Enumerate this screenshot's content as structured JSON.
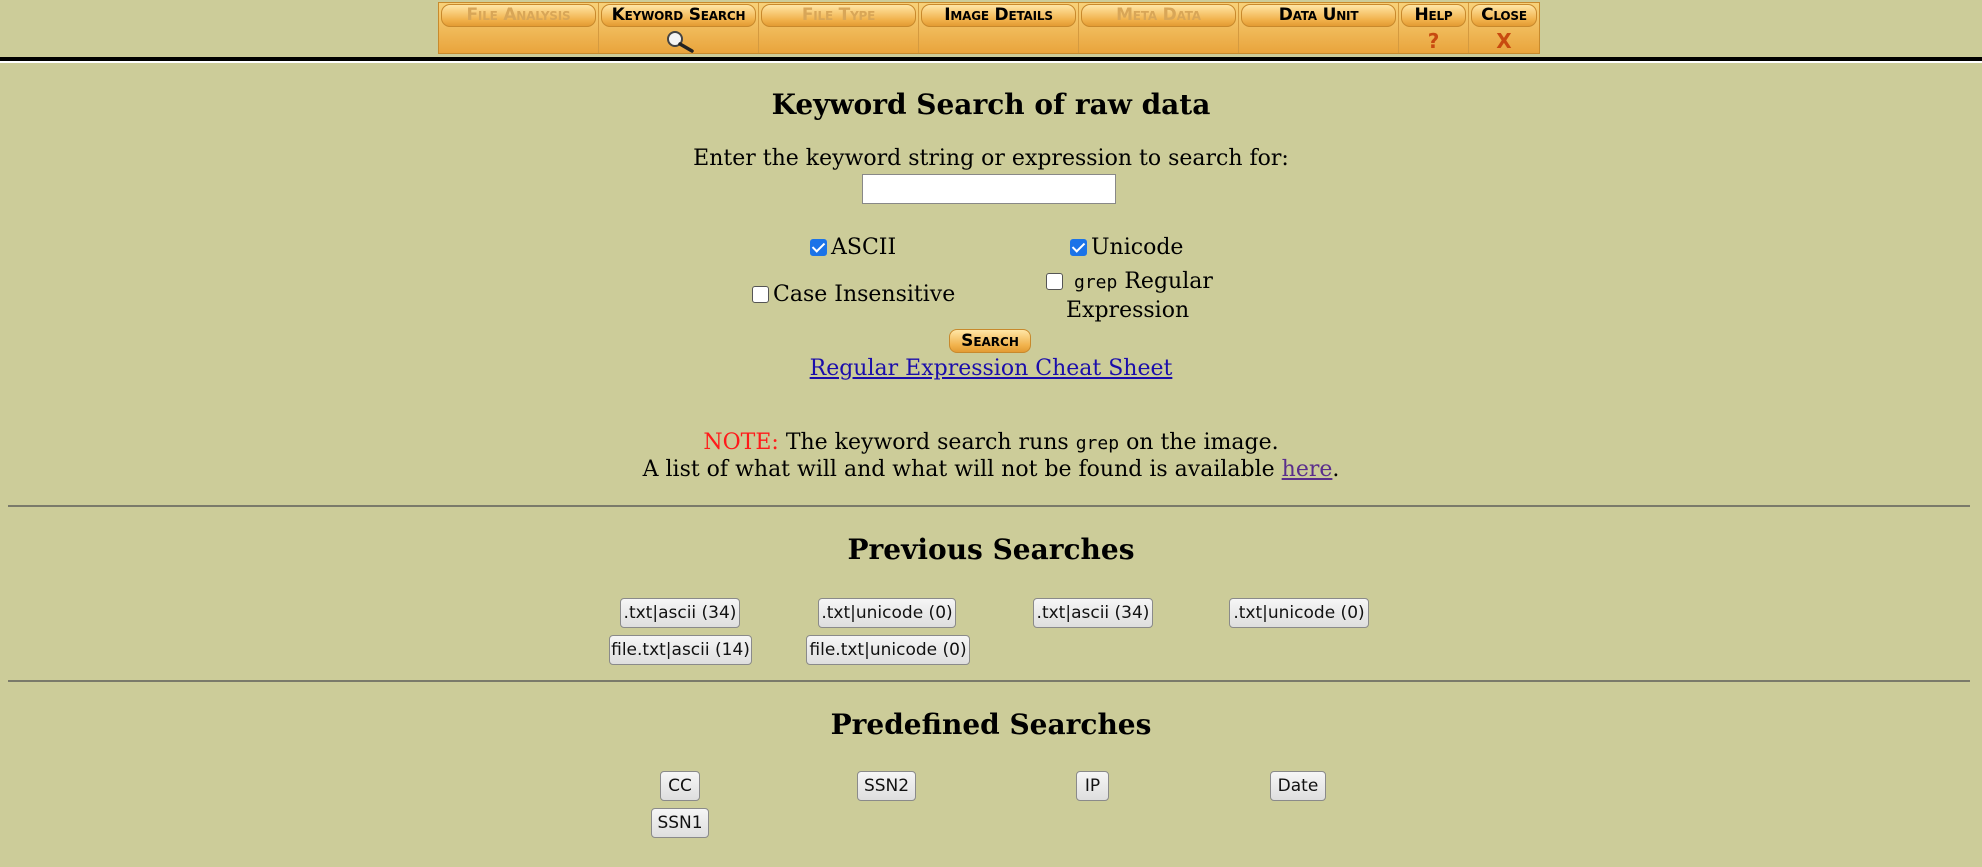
{
  "menu": {
    "tabs": [
      {
        "label": "File Analysis",
        "icon": "",
        "enabled": false
      },
      {
        "label": "Keyword Search",
        "icon": "magnifier-icon",
        "enabled": true
      },
      {
        "label": "File Type",
        "icon": "",
        "enabled": false
      },
      {
        "label": "Image Details",
        "icon": "",
        "enabled": true
      },
      {
        "label": "Meta Data",
        "icon": "",
        "enabled": false
      },
      {
        "label": "Data Unit",
        "icon": "",
        "enabled": true
      },
      {
        "label": "Help",
        "icon_text": "?",
        "enabled": true
      },
      {
        "label": "Close",
        "icon_text": "X",
        "enabled": true
      }
    ]
  },
  "keyword_search": {
    "title": "Keyword Search of raw data",
    "prompt": "Enter the keyword string or expression to search for:",
    "input_value": "",
    "options": {
      "ascii": {
        "label": "ASCII",
        "checked": true
      },
      "unicode": {
        "label": "Unicode",
        "checked": true
      },
      "case_insensitive": {
        "label": "Case Insensitive",
        "checked": false
      },
      "grep_regex": {
        "label_mono": "grep",
        "label_line1": "Regular",
        "label_line2": "Expression",
        "checked": false
      }
    },
    "search_button": "Search",
    "cheat_sheet_link": "Regular Expression Cheat Sheet",
    "note": {
      "label": "NOTE:",
      "text_before": "The keyword search runs",
      "mono": "grep",
      "text_after": "on the image.",
      "line2": "A list of what will and what will not be found is available",
      "link": "here",
      "period": "."
    }
  },
  "previous_searches": {
    "title": "Previous Searches",
    "items": [
      ".txt|ascii (34)",
      ".txt|unicode (0)",
      ".txt|ascii (34)",
      ".txt|unicode (0)",
      "file.txt|ascii (14)",
      "file.txt|unicode (0)"
    ]
  },
  "predefined_searches": {
    "title": "Predefined Searches",
    "items": [
      "CC",
      "SSN2",
      "IP",
      "Date",
      "SSN1"
    ]
  },
  "colors": {
    "background": "#cccc99",
    "tab_bar": "#f1b24c",
    "note_red": "#ff1a1a",
    "link_blue": "#1a0dab",
    "checkbox_blue": "#1a73e8"
  }
}
